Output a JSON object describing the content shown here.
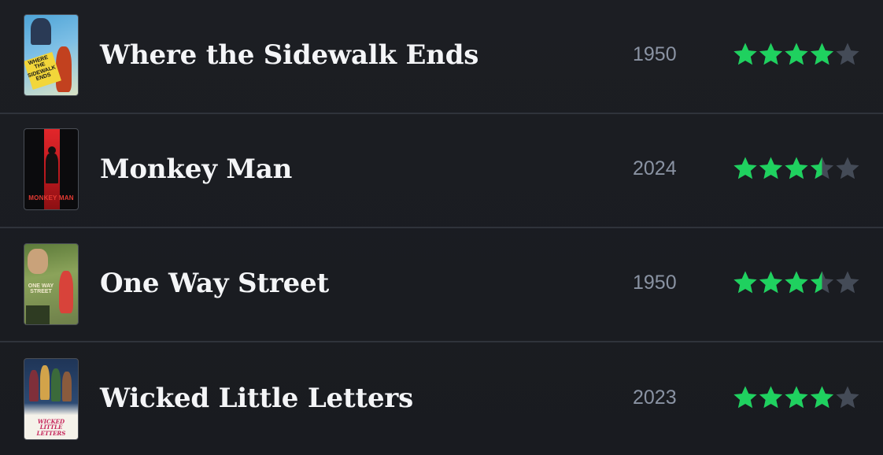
{
  "colors": {
    "background": "#1b1d22",
    "divider": "#2f333b",
    "title": "#f4f5f7",
    "year": "#8a93a3",
    "star_filled": "#1fd15f",
    "star_empty": "#444b57"
  },
  "films": [
    {
      "title": "Where the Sidewalk Ends",
      "year": "1950",
      "rating": 4,
      "poster": {
        "icon": "poster-where-the-sidewalk-ends",
        "text": "WHERE THE SIDEWALK ENDS"
      }
    },
    {
      "title": "Monkey Man",
      "year": "2024",
      "rating": 3.5,
      "poster": {
        "icon": "poster-monkey-man",
        "text": "MONKEY MAN"
      }
    },
    {
      "title": "One Way Street",
      "year": "1950",
      "rating": 3.5,
      "poster": {
        "icon": "poster-one-way-street",
        "text": "ONE WAY STREET"
      }
    },
    {
      "title": "Wicked Little Letters",
      "year": "2023",
      "rating": 4,
      "poster": {
        "icon": "poster-wicked-little-letters",
        "text": "WICKED LITTLE LETTERS"
      }
    }
  ]
}
